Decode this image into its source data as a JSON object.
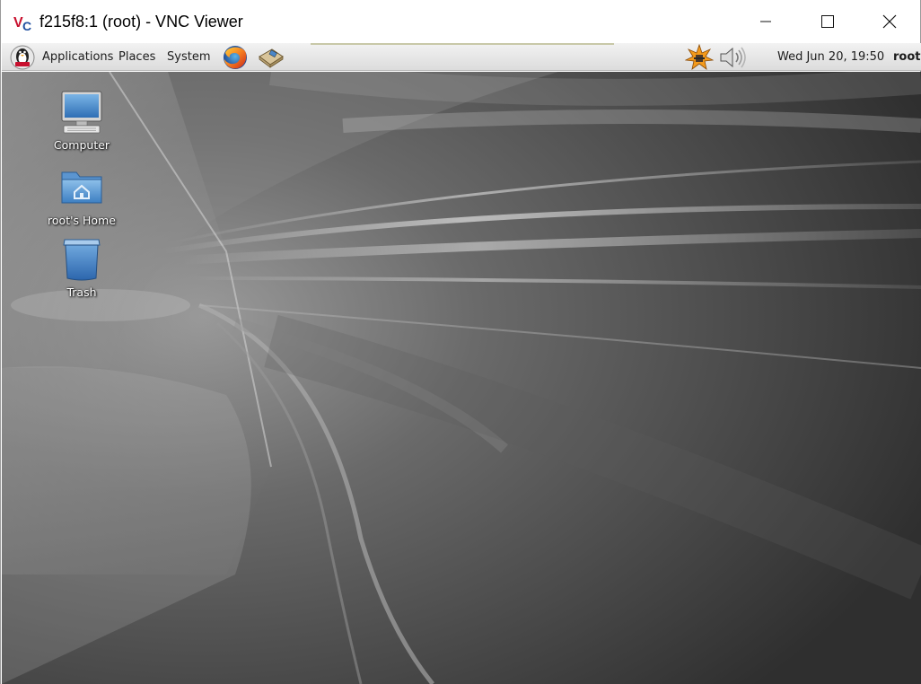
{
  "window": {
    "title": "f215f8:1 (root) - VNC Viewer",
    "logo_icon": "vnc-logo-icon",
    "controls": [
      "minimize-icon",
      "maximize-icon",
      "close-icon"
    ]
  },
  "panel": {
    "menus": {
      "applications": "Applications",
      "places": "Places",
      "system": "System"
    },
    "launchers": [
      "distro-logo-icon",
      "firefox-icon",
      "email-icon"
    ],
    "tray": [
      "update-notifier-icon",
      "volume-icon"
    ],
    "clock": "Wed Jun 20, 19:50",
    "user": "root"
  },
  "desktop": {
    "icons": [
      {
        "label": "Computer",
        "icon": "computer-icon"
      },
      {
        "label": "root's Home",
        "icon": "home-folder-icon"
      },
      {
        "label": "Trash",
        "icon": "trash-icon"
      }
    ],
    "wallpaper_colors": [
      "#2e2e2e",
      "#6b6b6b",
      "#d0d0d0"
    ]
  }
}
